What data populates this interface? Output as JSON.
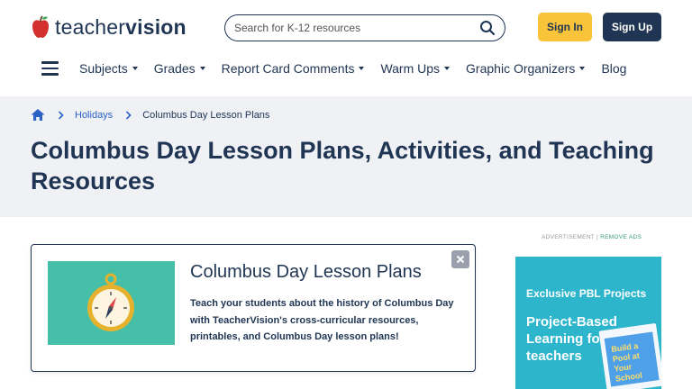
{
  "header": {
    "logo_text_light": "teacher",
    "logo_text_bold": "vision",
    "search_placeholder": "Search for K-12 resources",
    "signin_label": "Sign In",
    "signup_label": "Sign Up"
  },
  "nav": {
    "items": [
      {
        "label": "Subjects",
        "dropdown": true
      },
      {
        "label": "Grades",
        "dropdown": true
      },
      {
        "label": "Report Card Comments",
        "dropdown": true
      },
      {
        "label": "Warm Ups",
        "dropdown": true
      },
      {
        "label": "Graphic Organizers",
        "dropdown": true
      },
      {
        "label": "Blog",
        "dropdown": false
      }
    ]
  },
  "breadcrumb": {
    "link": "Holidays",
    "current": "Columbus Day Lesson Plans"
  },
  "page_title": "Columbus Day Lesson Plans, Activities, and Teaching Resources",
  "card": {
    "title": "Columbus Day Lesson Plans",
    "description": "Teach your students about the history of Columbus Day with TeacherVision's cross-curricular resources, printables, and Columbus Day lesson plans!"
  },
  "ad": {
    "label": "ADVERTISEMENT",
    "separator": "|",
    "remove_label": "REMOVE ADS",
    "tagline": "Exclusive PBL Projects",
    "headline": "Project-Based Learning for busy teachers",
    "book_text": "Build a Pool at Your School"
  },
  "colors": {
    "navy": "#1f3553",
    "accent_yellow": "#f9c33a",
    "link_blue": "#2b62c4",
    "hero_bg": "#eff1f5",
    "card_image_bg": "#45bfa7",
    "ad_bg": "#2db5cc",
    "apple_red": "#d32f2f"
  }
}
